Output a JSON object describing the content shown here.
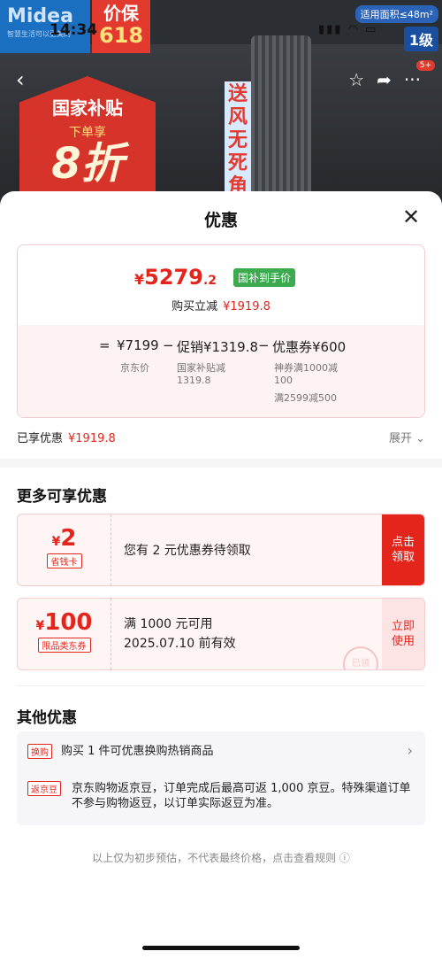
{
  "status": {
    "time": "14:34",
    "icons": "▮▮▮ ◠ ▭"
  },
  "banner": {
    "brand_logo": "Midea",
    "brand_sub": "智慧生活可以更美的",
    "price_guard_line1": "价保",
    "price_guard_line2": "618",
    "area_tag": "适用面积≤48m²",
    "energy_tag": "1级",
    "vertical_text": "送风无死角",
    "subsidy_line1": "国家补贴",
    "subsidy_line2": "下单享",
    "subsidy_line3": "8折",
    "badge_count": "5+"
  },
  "sheet": {
    "title": "优惠",
    "price": {
      "currency": "¥",
      "integer": "5279",
      "decimal": ".2",
      "badge": "国补到手价"
    },
    "instant_label": "购买立减",
    "instant_amount": "¥1919.8",
    "equation": {
      "eq": "=",
      "jd_price": "¥7199",
      "minus1": "−",
      "promo": "促销¥1319.8",
      "minus2": "−",
      "coupon": "优惠券¥600",
      "jd_price_sub": "京东价",
      "promo_sub": "国家补贴减\n1319.8",
      "coupon_sub1": "神券满1000减\n100",
      "coupon_sub2": "满2599减500"
    },
    "enjoyed_label": "已享优惠",
    "enjoyed_amount": "¥1919.8",
    "expand_label": "展开 ⌄",
    "more_title": "更多可享优惠",
    "coupons": [
      {
        "currency": "¥",
        "value": "2",
        "tag": "省钱卡",
        "line1": "您有 2 元优惠券待领取",
        "line2": "",
        "action": "点击\n领取"
      },
      {
        "currency": "¥",
        "value": "100",
        "tag": "限品类东券",
        "line1": "满 1000 元可用",
        "line2": "2025.07.10 前有效",
        "action": "立即\n使用",
        "stamp": "已领"
      }
    ],
    "other_title": "其他优惠",
    "others": [
      {
        "tag": "换购",
        "text": "购买 1 件可优惠换购热销商品",
        "chevron": "›"
      },
      {
        "tag": "返京豆",
        "text": "京东购物返京豆，订单完成后最高可返 1,000 京豆。特殊渠道订单不参与购物返豆，以订单实际返豆为准。"
      }
    ],
    "footnote": "以上仅为初步预估，不代表最终价格，点击查看规则 ⓘ"
  },
  "colors": {
    "accent_red": "#e3251c",
    "green_badge": "#3cab50"
  }
}
